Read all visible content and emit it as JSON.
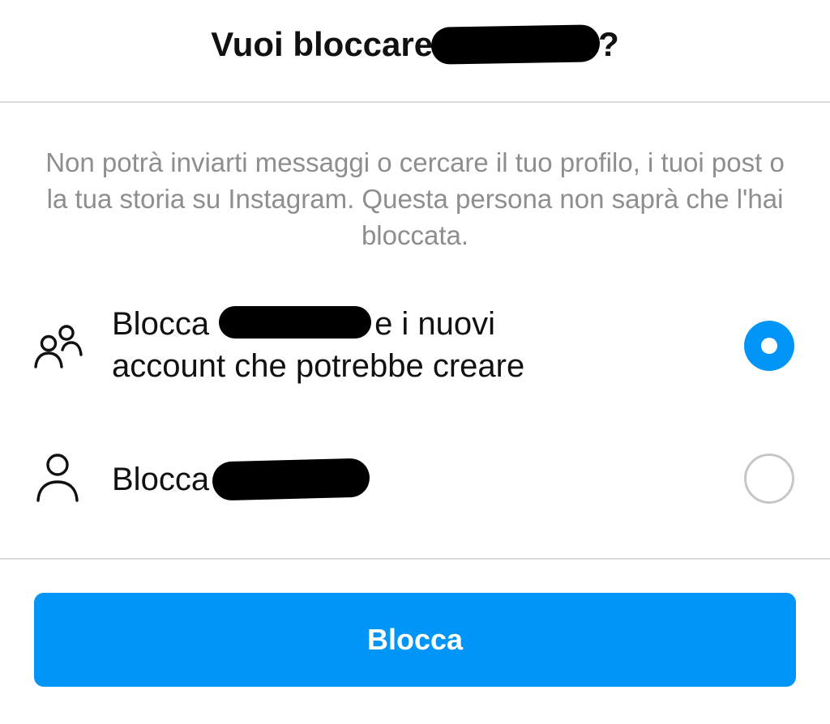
{
  "dialog": {
    "title_prefix": "Vuoi bloccare",
    "title_suffix": "?",
    "description": "Non potrà inviarti messaggi o cercare il tuo profilo, i tuoi post o la tua storia su Instagram. Questa persona non saprà che l'hai bloccata."
  },
  "options": [
    {
      "icon": "people-icon",
      "label_prefix": "Blocca",
      "label_line1_suffix": "e i nuovi",
      "label_line2": "account che potrebbe creare",
      "selected": true
    },
    {
      "icon": "person-icon",
      "label_prefix": "Blocca",
      "selected": false
    }
  ],
  "actions": {
    "block_label": "Blocca"
  },
  "colors": {
    "accent": "#0095f6",
    "text": "#111111",
    "muted_text": "#8e8e8e",
    "divider": "#dbdbdb",
    "radio_unselected": "#c7c7c7"
  }
}
